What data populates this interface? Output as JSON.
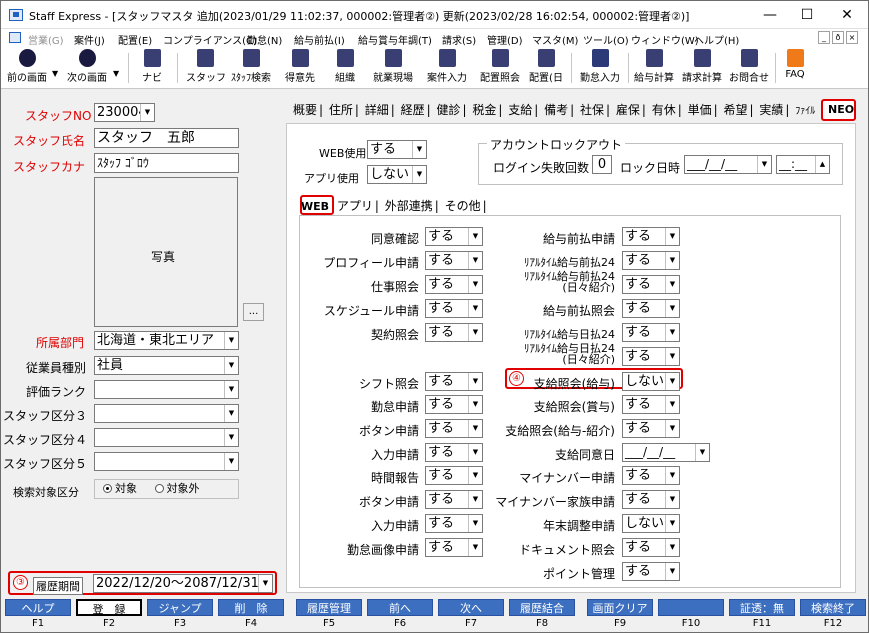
{
  "window": {
    "title": "Staff Express - [スタッフマスタ 追加(2023/01/29 11:02:37, 000002:管理者②) 更新(2023/02/28 16:02:54, 000002:管理者②)]",
    "controls": {
      "minimize": "—",
      "maximize": "☐",
      "close": "✕"
    }
  },
  "menu": [
    {
      "label": "営業(G)",
      "dim": true
    },
    {
      "label": "案件(J)"
    },
    {
      "label": "配置(E)"
    },
    {
      "label": "コンプライアンス(C)"
    },
    {
      "label": "勤怠(N)"
    },
    {
      "label": "給与前払(I)"
    },
    {
      "label": "給与賞与年調(T)"
    },
    {
      "label": "請求(S)"
    },
    {
      "label": "管理(D)"
    },
    {
      "label": "マスタ(M)"
    },
    {
      "label": "ツール(O)"
    },
    {
      "label": "ウィンドウ(W)"
    },
    {
      "label": "ヘルプ(H)"
    }
  ],
  "menu_right": {
    "min": "_",
    "restore": "ð",
    "close": "×"
  },
  "toolbar": [
    {
      "label": "前の画面",
      "icon": "back-arrow-icon"
    },
    {
      "label": "次の画面",
      "icon": "forward-arrow-icon"
    },
    {
      "label": "ナビ",
      "icon": "navi-icon"
    },
    {
      "label": "スタッフ",
      "icon": "staff-icon"
    },
    {
      "label": "ｽﾀｯﾌ検索",
      "icon": "staff-search-icon"
    },
    {
      "label": "得意先",
      "icon": "client-icon"
    },
    {
      "label": "組織",
      "icon": "organization-icon"
    },
    {
      "label": "就業現場",
      "icon": "worksite-icon"
    },
    {
      "label": "案件入力",
      "icon": "project-input-icon"
    },
    {
      "label": "配置照会",
      "icon": "assignment-icon"
    },
    {
      "label": "配置(日",
      "icon": "assignment-day-icon"
    },
    {
      "label": "勤怠入力",
      "icon": "attendance-icon"
    },
    {
      "label": "給与計算",
      "icon": "payroll-icon"
    },
    {
      "label": "請求計算",
      "icon": "billing-icon"
    },
    {
      "label": "お問合せ",
      "icon": "inquiry-icon"
    },
    {
      "label": "FAQ",
      "icon": "faq-icon"
    }
  ],
  "left": {
    "staff_no_label": "スタッフNO",
    "staff_no": "230004",
    "staff_name_label": "スタッフ氏名",
    "staff_name": "スタッフ　五郎",
    "staff_kana_label": "スタッフカナ",
    "staff_kana": "ｽﾀｯﾌ ｺﾞﾛｳ",
    "photo_label": "写真",
    "photo_button": "...",
    "dept_label": "所属部門",
    "dept": "北海道・東北エリア",
    "emp_type_label": "従業員種別",
    "emp_type": "社員",
    "rank_label": "評価ランク",
    "rank": "",
    "cat3_label": "スタッフ区分３",
    "cat3": "",
    "cat4_label": "スタッフ区分４",
    "cat4": "",
    "cat5_label": "スタッフ区分５",
    "cat5": "",
    "search_label": "検索対象区分",
    "search_on": "対象",
    "search_off": "対象外",
    "history_num": "③",
    "history_label": "履歴期間",
    "history_value": "2022/12/20～2087/12/31"
  },
  "tabs": [
    "概要",
    "住所",
    "詳細",
    "経歴",
    "健診",
    "税金",
    "支給",
    "備考",
    "社保",
    "雇保",
    "有休",
    "単価",
    "希望",
    "実績",
    "ﾌｧｲﾙ",
    "NEO"
  ],
  "neo": {
    "web_use_label": "WEB使用",
    "web_use": "する",
    "app_use_label": "アプリ使用",
    "app_use": "しない",
    "lockout_caption": "アカウントロックアウト",
    "login_fail_label": "ログイン失敗回数",
    "login_fail": "0",
    "lock_date_label": "ロック日時",
    "lock_date": "___/__/__",
    "lock_time": "__:__",
    "subtabs": [
      "WEB",
      "アプリ",
      "外部連携",
      "その他"
    ],
    "left_items": [
      {
        "label": "同意確認",
        "value": "する"
      },
      {
        "label": "プロフィール申請",
        "value": "する"
      },
      {
        "label": "仕事照会",
        "value": "する"
      },
      {
        "label": "スケジュール申請",
        "value": "する"
      },
      {
        "label": "契約照会",
        "value": "する"
      },
      {
        "label": "シフト照会",
        "value": "する"
      },
      {
        "label": "勤怠申請",
        "value": "する"
      },
      {
        "label": "ボタン申請",
        "value": "する"
      },
      {
        "label": "入力申請",
        "value": "する"
      },
      {
        "label": "時間報告",
        "value": "する"
      },
      {
        "label": "ボタン申請",
        "value": "する"
      },
      {
        "label": "入力申請",
        "value": "する"
      },
      {
        "label": "勤怠画像申請",
        "value": "する"
      }
    ],
    "right_items": [
      {
        "label": "給与前払申請",
        "value": "する"
      },
      {
        "label": "ﾘｱﾙﾀｲﾑ給与前払24",
        "value": "する"
      },
      {
        "label": "ﾘｱﾙﾀｲﾑ給与前払24",
        "label2": "(日々紹介)",
        "value": "する"
      },
      {
        "label": "給与前払照会",
        "value": "する"
      },
      {
        "label": "ﾘｱﾙﾀｲﾑ給与日払24",
        "value": "する"
      },
      {
        "label": "ﾘｱﾙﾀｲﾑ給与日払24",
        "label2": "(日々紹介)",
        "value": "する"
      },
      {
        "label": "支給照会(給与)",
        "value": "しない"
      },
      {
        "label": "支給照会(賞与)",
        "value": "する"
      },
      {
        "label": "支給照会(給与-紹介)",
        "value": "する"
      },
      {
        "label": "支給同意日",
        "value": "___/__/__"
      },
      {
        "label": "マイナンバー申請",
        "value": "する"
      },
      {
        "label": "マイナンバー家族申請",
        "value": "する"
      },
      {
        "label": "年末調整申請",
        "value": "しない"
      },
      {
        "label": "ドキュメント照会",
        "value": "する"
      },
      {
        "label": "ポイント管理",
        "value": "する"
      }
    ],
    "marker4": "④"
  },
  "fkeys": [
    {
      "label": "ヘルプ",
      "key": "F1"
    },
    {
      "label": "登　録",
      "key": "F2"
    },
    {
      "label": "ジャンプ",
      "key": "F3"
    },
    {
      "label": "削　除",
      "key": "F4"
    },
    {
      "label": "履歴管理",
      "key": "F5"
    },
    {
      "label": "前へ",
      "key": "F6"
    },
    {
      "label": "次へ",
      "key": "F7"
    },
    {
      "label": "履歴結合",
      "key": "F8"
    },
    {
      "label": "画面クリア",
      "key": "F9"
    },
    {
      "label": "",
      "key": "F10"
    },
    {
      "label": "証透：無",
      "key": "F11"
    },
    {
      "label": "検索終了",
      "key": "F12"
    }
  ],
  "colors": {
    "accent_red": "#e00000",
    "fkey_blue": "#3c6fc0"
  }
}
